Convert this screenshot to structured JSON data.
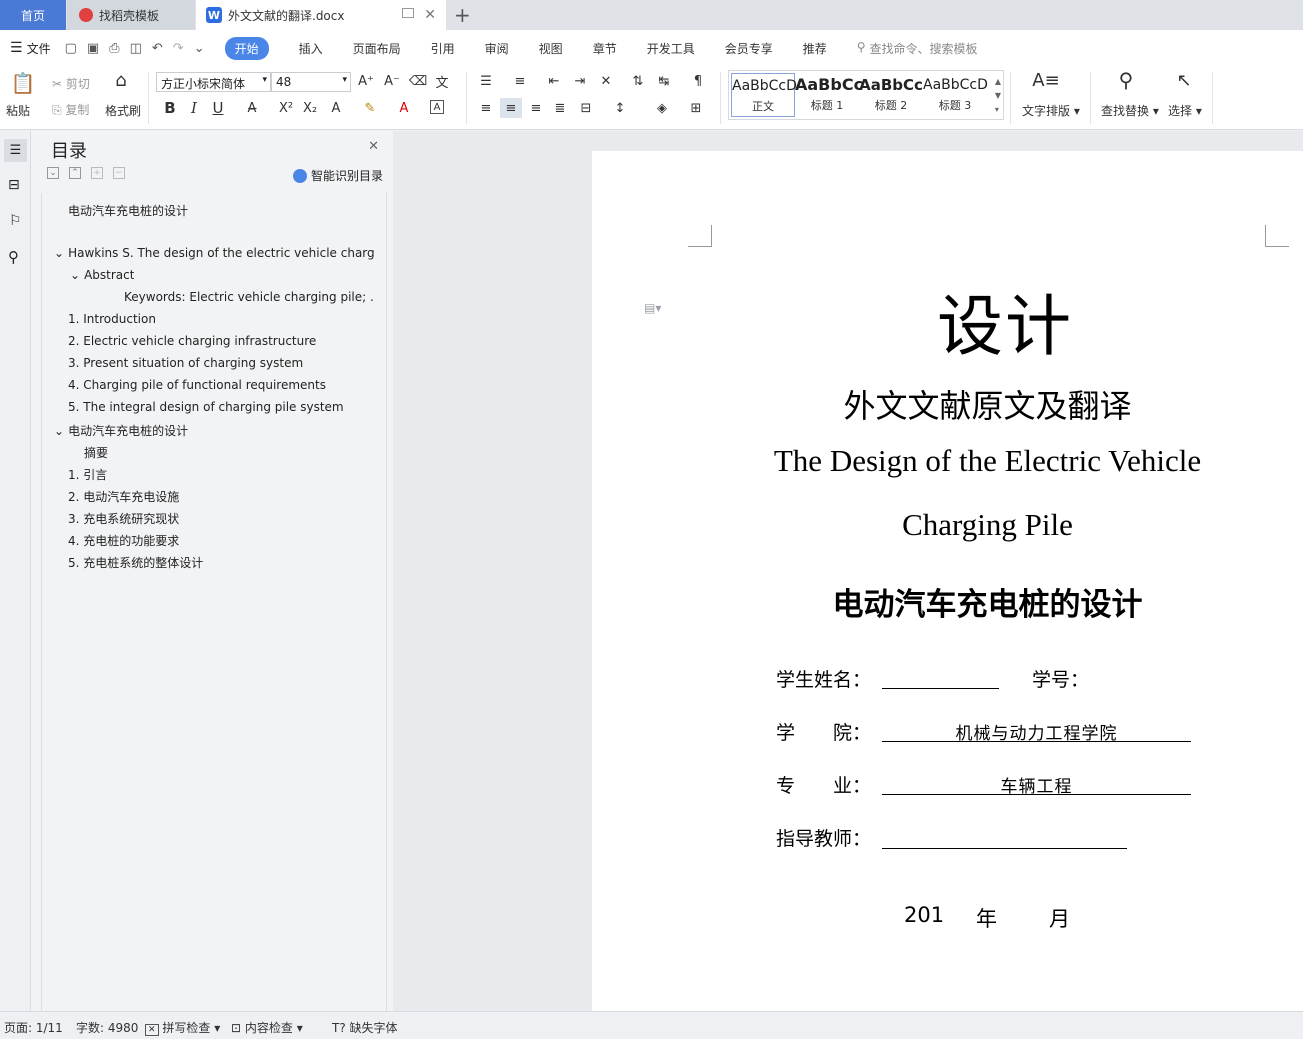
{
  "tabs": {
    "home": "首页",
    "template": "找稻壳模板",
    "doc": "外文文献的翻译.docx",
    "doc_icon": "W"
  },
  "menu": {
    "file": "文件",
    "items": [
      "开始",
      "插入",
      "页面布局",
      "引用",
      "审阅",
      "视图",
      "章节",
      "开发工具",
      "会员专享",
      "推荐"
    ],
    "search_placeholder": "查找命令、搜索模板"
  },
  "ribbon": {
    "paste": "粘贴",
    "cut": "剪切",
    "copy": "复制",
    "format_painter": "格式刷",
    "font_name": "方正小标宋简体",
    "font_size": "48",
    "styles": [
      {
        "sample": "AaBbCcD",
        "name": "正文"
      },
      {
        "sample": "AaBbCc",
        "name": "标题 1"
      },
      {
        "sample": "AaBbCc",
        "name": "标题 2"
      },
      {
        "sample": "AaBbCcD",
        "name": "标题 3"
      }
    ],
    "text_layout": "文字排版",
    "find_replace": "查找替换",
    "select": "选择"
  },
  "nav": {
    "title": "目录",
    "smart": "智能识别目录",
    "items": [
      {
        "text": "电动汽车充电桩的设计",
        "level": 0,
        "arrow": ""
      },
      {
        "text": "Hawkins S. The design of the electric vehicle charg ...",
        "level": 0,
        "arrow": "v"
      },
      {
        "text": "Abstract",
        "level": 1,
        "arrow": "v"
      },
      {
        "text": "Keywords: Electric vehicle charging pile; ...",
        "level": 3,
        "arrow": ""
      },
      {
        "text": "1. Introduction",
        "level": 0,
        "arrow": ""
      },
      {
        "text": "2. Electric vehicle charging infrastructure",
        "level": 0,
        "arrow": ""
      },
      {
        "text": "3. Present situation of charging system",
        "level": 0,
        "arrow": ""
      },
      {
        "text": "4. Charging pile of functional requirements",
        "level": 0,
        "arrow": ""
      },
      {
        "text": "5. The integral design of charging pile system",
        "level": 0,
        "arrow": ""
      },
      {
        "text": "电动汽车充电桩的设计",
        "level": 0,
        "arrow": "v"
      },
      {
        "text": "摘要",
        "level": 1,
        "arrow": ""
      },
      {
        "text": "1.  引言",
        "level": 0,
        "arrow": ""
      },
      {
        "text": "2.  电动汽车充电设施",
        "level": 0,
        "arrow": ""
      },
      {
        "text": "3.  充电系统研究现状",
        "level": 0,
        "arrow": ""
      },
      {
        "text": "4.  充电桩的功能要求",
        "level": 0,
        "arrow": ""
      },
      {
        "text": "5.  充电桩系统的整体设计",
        "level": 0,
        "arrow": ""
      }
    ]
  },
  "document": {
    "title": "设计",
    "subtitle": "外文文献原文及翻译",
    "en_title_line1": "The Design of the Electric Vehicle",
    "en_title_line2": "Charging Pile",
    "cn_title": "电动汽车充电桩的设计",
    "student_name_label": "学生姓名：",
    "student_id_label": "学号：",
    "college_label": "学　　院：",
    "college_value": "机械与动力工程学院",
    "major_label": "专　　业：",
    "major_value": "车辆工程",
    "advisor_label": "指导教师：",
    "date_year": "201",
    "date_y": "年",
    "date_m": "月"
  },
  "status": {
    "page": "页面: 1/11",
    "words": "字数: 4980",
    "spell": "拼写检查",
    "content": "内容检查",
    "missing_font": "缺失字体"
  },
  "colors": {
    "accent": "#4a86e8",
    "home_tab": "#4a79d6"
  }
}
